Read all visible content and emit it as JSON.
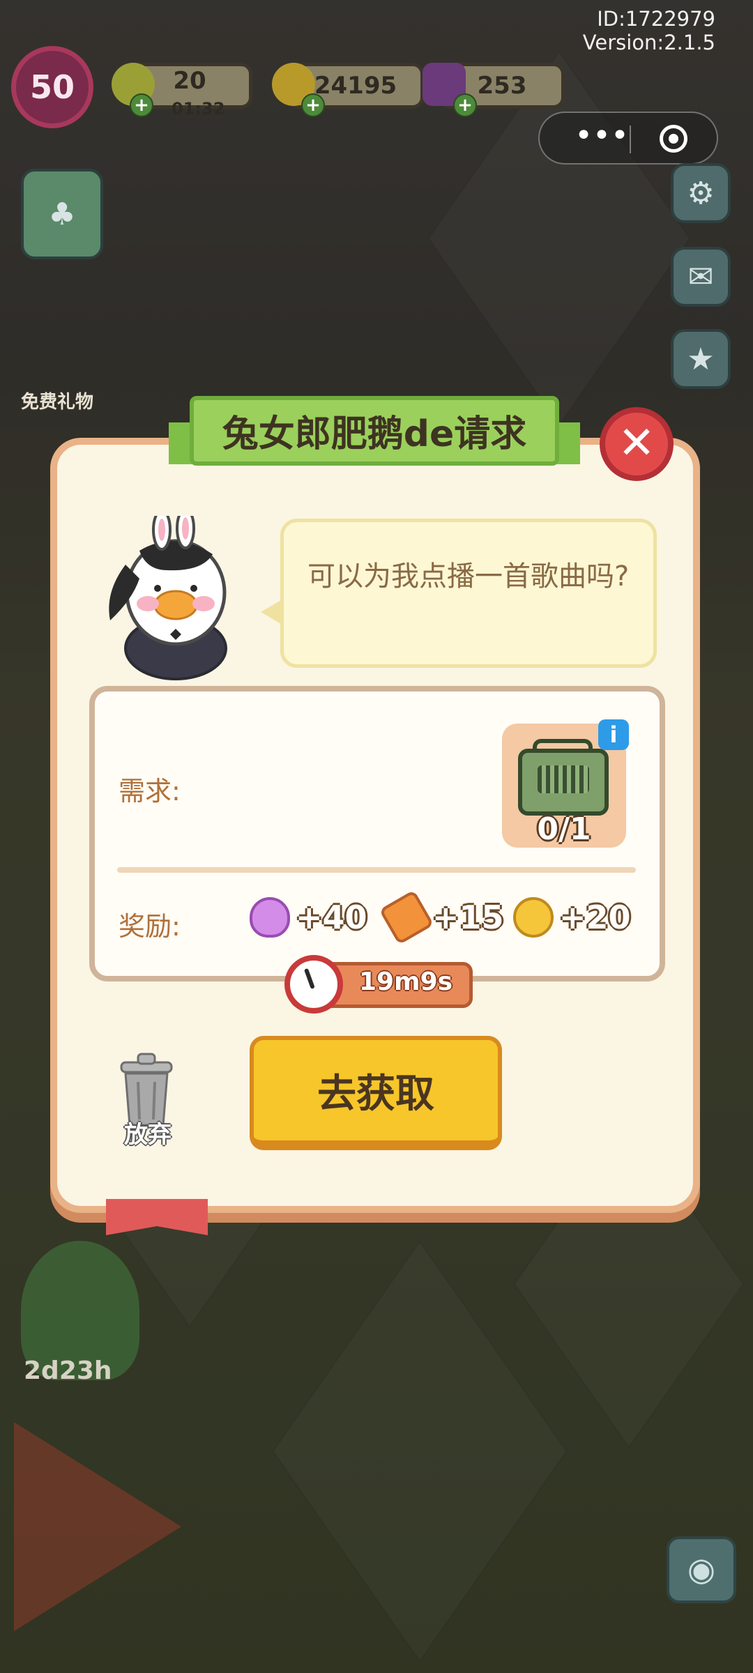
{
  "header": {
    "id_text": "ID:1722979",
    "version_text": "Version:2.1.5",
    "level": "50",
    "energy": {
      "value": "20",
      "timer": "01:32"
    },
    "coins": "24195",
    "gems": "253"
  },
  "left_panel": {
    "free_gift_label": "免费礼物",
    "bottom_timer": "2d23h"
  },
  "dialog": {
    "title": "兔女郎肥鹅de请求",
    "speech": "可以为我点播一首歌曲吗?",
    "need_label": "需求:",
    "item": {
      "icon": "radio-icon",
      "progress": "0/1"
    },
    "reward_label": "奖励:",
    "rewards": [
      {
        "icon": "heart-icon",
        "value": "+40"
      },
      {
        "icon": "ticket-icon",
        "value": "+15"
      },
      {
        "icon": "coin-icon",
        "value": "+20"
      }
    ],
    "timer": "19m9s",
    "abandon_label": "放弃",
    "go_label": "去获取"
  },
  "colors": {
    "accent_yellow": "#f7c62a",
    "title_green": "#9bd05c",
    "close_red": "#e24a4a",
    "frame": "#e9b287"
  }
}
